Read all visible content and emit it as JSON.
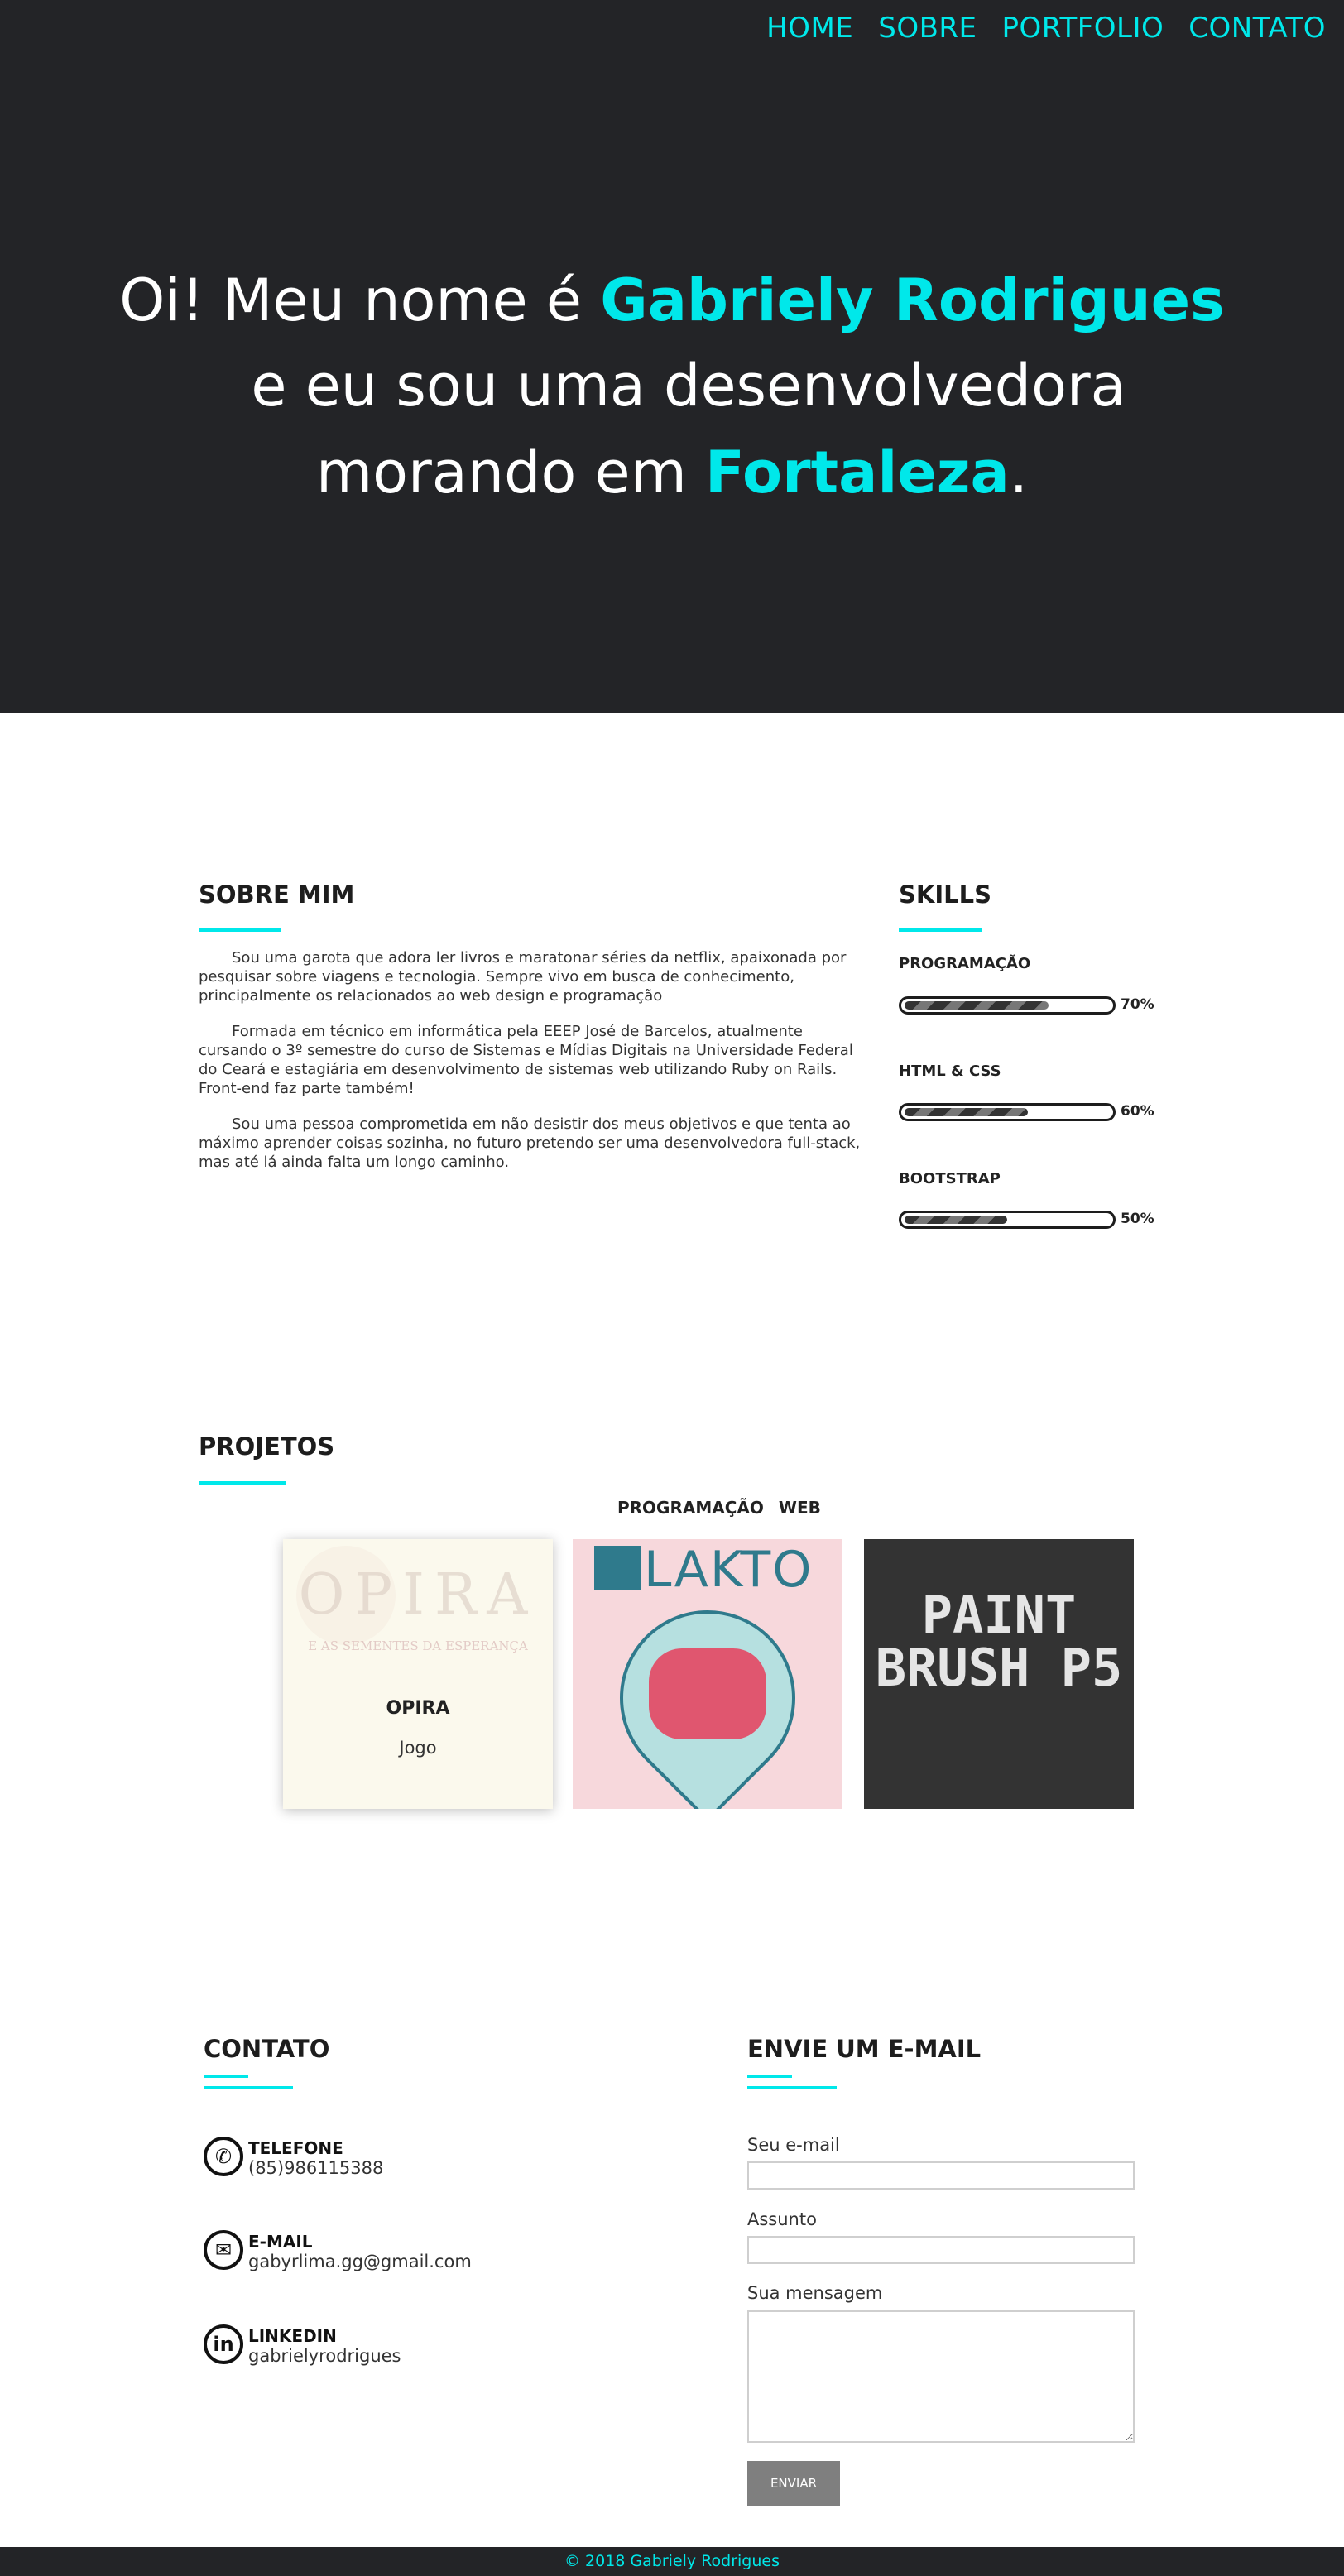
{
  "nav": {
    "items": [
      "HOME",
      "SOBRE",
      "PORTFOLIO",
      "CONTATO"
    ]
  },
  "hero": {
    "line1_prefix": "Oi! Meu nome é ",
    "line1_name": "Gabriely Rodrigues",
    "line2": "e eu sou uma desenvolvedora",
    "line3_prefix": "morando em ",
    "line3_city": "Fortaleza",
    "line3_suffix": "."
  },
  "about": {
    "title": "SOBRE MIM",
    "paragraphs": [
      "Sou uma garota que adora ler livros e maratonar séries da netflix, apaixonada por pesquisar sobre viagens e tecnologia. Sempre vivo em busca de conhecimento, principalmente os relacionados ao web design e programação",
      "Formada em técnico em informática pela EEEP José de Barcelos, atualmente cursando o 3º semestre do curso de Sistemas e Mídias Digitais na Universidade Federal do Ceará e estagiária em desenvolvimento de sistemas web utilizando Ruby on Rails. Front-end faz parte também!",
      "Sou uma pessoa comprometida em não desistir dos meus objetivos e que tenta ao máximo aprender coisas sozinha, no futuro pretendo ser uma desenvolvedora full-stack, mas até lá ainda falta um longo caminho."
    ]
  },
  "skills": {
    "title": "SKILLS",
    "items": [
      {
        "label": "PROGRAMAÇÃO",
        "percent_text": "70%",
        "value": 70
      },
      {
        "label": "HTML & CSS",
        "percent_text": "60%",
        "value": 60
      },
      {
        "label": "BOOTSTRAP",
        "percent_text": "50%",
        "value": 50
      }
    ]
  },
  "projects": {
    "title": "PROJETOS",
    "filters": [
      "PROGRAMAÇÃO",
      "WEB"
    ],
    "items": [
      {
        "name": "OPIRA",
        "category": "Jogo",
        "image_title": "OPIRA",
        "image_subtitle": "E AS SEMENTES DA ESPERANÇA"
      },
      {
        "image_title": "LAKTO"
      },
      {
        "image_text": "PAINT BRUSH P5"
      }
    ]
  },
  "contact": {
    "title": "CONTATO",
    "items": [
      {
        "label": "TELEFONE",
        "value": "(85)986115388",
        "icon": "phone-icon"
      },
      {
        "label": "E-MAIL",
        "value": "gabyrlima.gg@gmail.com",
        "icon": "mail-icon"
      },
      {
        "label": "LINKEDIN",
        "value": "gabrielyrodrigues",
        "icon": "linkedin-icon"
      }
    ]
  },
  "email_form": {
    "title": "ENVIE UM E-MAIL",
    "email_label": "Seu e-mail",
    "subject_label": "Assunto",
    "message_label": "Sua mensagem",
    "submit_label": "ENVIAR"
  },
  "footer": {
    "text": "© 2018 Gabriely Rodrigues"
  },
  "colors": {
    "accent": "#00e8ea",
    "dark": "#232427"
  }
}
